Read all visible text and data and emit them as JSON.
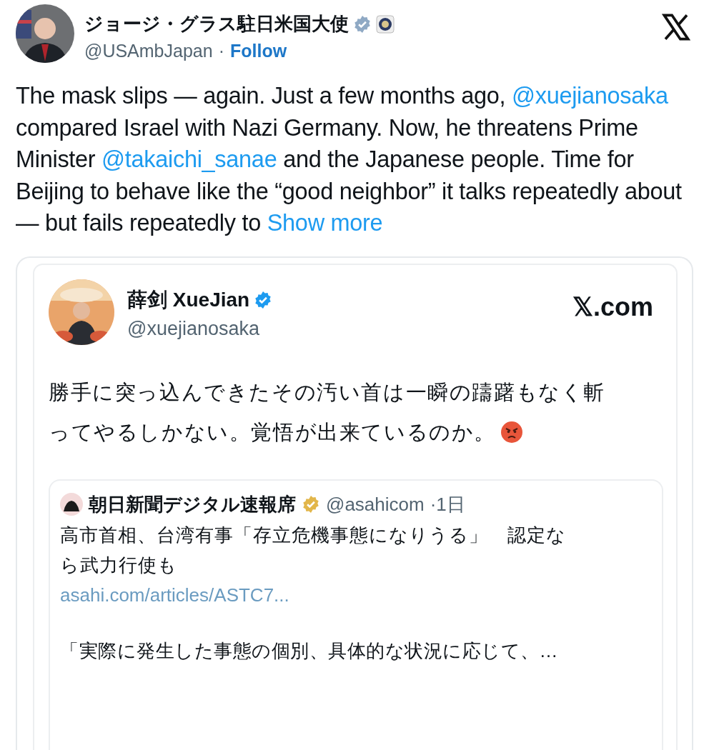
{
  "author": {
    "name": "ジョージ・グラス駐日米国大使",
    "handle": "@USAmbJapan",
    "separator": "·",
    "follow": "Follow"
  },
  "body": [
    {
      "kind": "text",
      "text": "The mask slips — again. Just a few months ago, "
    },
    {
      "kind": "mention",
      "text": "@xuejianosaka"
    },
    {
      "kind": "text",
      "text": " compared Israel with Nazi Germany. Now, he threatens Prime Minister "
    },
    {
      "kind": "mention",
      "text": "@takaichi_sanae"
    },
    {
      "kind": "text",
      "text": " and the Japanese people. Time for Beijing to behave like the “good neighbor” it talks repeatedly about — but fails repeatedly to "
    },
    {
      "kind": "more",
      "text": "Show more"
    }
  ],
  "embed": {
    "name": "薛剑 XueJian",
    "handle": "@xuejianosaka",
    "site": "𝕏.com",
    "text_lines": [
      "勝手に突っ込んできたその汚い首は一瞬の躊躇もなく斬",
      "ってやるしかない。覚悟が出来ているのか。"
    ],
    "quote": {
      "name": "朝日新聞デジタル速報席",
      "handle": "@asahicom",
      "time": "·1日",
      "text": "高市首相、台湾有事「存立危機事態になりうる」　認定なら武力行使も",
      "link": "asahi.com/articles/ASTC7...",
      "excerpt": "「実際に発生した事態の個別、具体的な状況に応じて、…"
    }
  }
}
